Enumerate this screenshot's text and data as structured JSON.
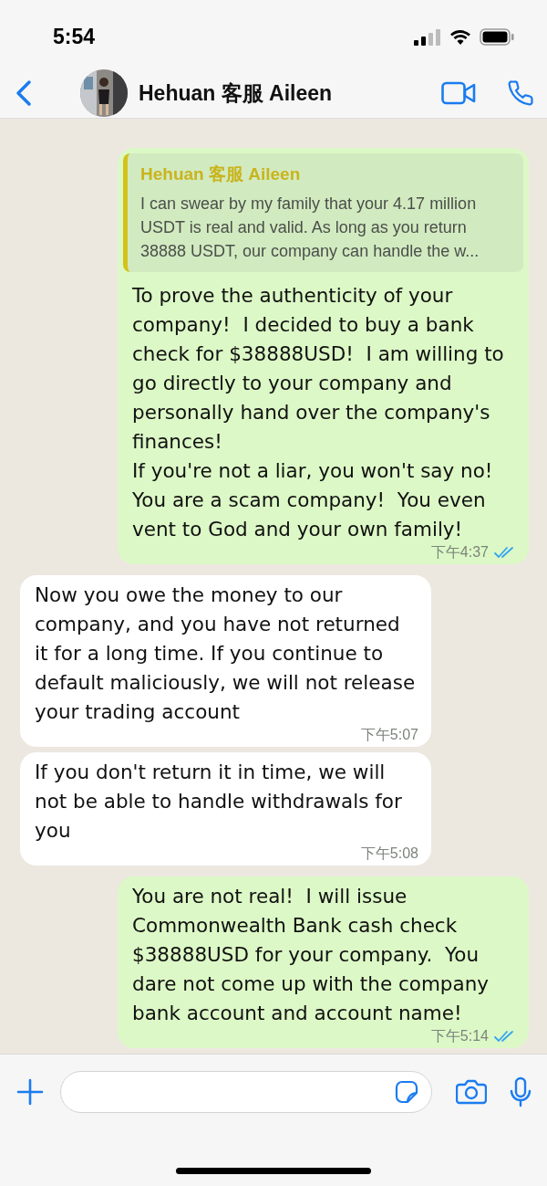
{
  "status_bar": {
    "time": "5:54"
  },
  "header": {
    "name": "Hehuan 客服 Aileen"
  },
  "messages": [
    {
      "kind": "outgoing",
      "quote": {
        "author": "Hehuan 客服 Aileen",
        "text": "I can swear by my family that your 4.17 million USDT is real and valid. As long as you return 38888 USDT, our company can handle the w..."
      },
      "text": "To prove the authenticity of your company!  I decided to buy a bank check for $38888USD!  I am willing to go directly to your company and personally hand over the company's finances!\nIf you're not a liar, you won't say no!  You are a scam company!  You even vent to God and your own family!",
      "time": "下午4:37",
      "read": true
    },
    {
      "kind": "incoming",
      "text": "Now you owe the money to our company, and you have not returned it for a long time. If you continue to default maliciously, we will not release your trading account",
      "time": "下午5:07"
    },
    {
      "kind": "incoming",
      "text": "If you don't return it in time, we will not be able to handle withdrawals for you",
      "time": "下午5:08"
    },
    {
      "kind": "outgoing",
      "text": "You are not real!  I will issue Commonwealth Bank cash check $38888USD for your company.  You dare not come up with the company bank account and account name!",
      "time": "下午5:14",
      "read": true
    }
  ]
}
